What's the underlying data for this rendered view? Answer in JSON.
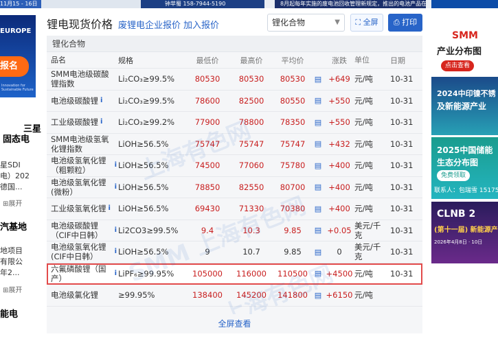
{
  "top_strip": {
    "left_text": "11月15 - 16日",
    "mid_text": "钟苹蜀 158-7944-5190",
    "right_text": "8月起每年实施的废电池回收管理新规定，推出的电池产品在新能源车..."
  },
  "left_sidebar": {
    "ad_line1": "EUROPE",
    "ad_line2": "报名",
    "ad_caption": "Innovation for Sustainable Future",
    "item1_title_a": "三星",
    "item1_title_b": "固态电",
    "item1_text_a": "星SDI",
    "item1_text_b": "电）202",
    "item1_text_c": "德国...",
    "expand_label": "展开",
    "item2_title": "汽基地",
    "item2_text_a": "地项目",
    "item2_text_b": "有限公",
    "item2_text_c": "年2...",
    "item3_title": "能电"
  },
  "header": {
    "title": "锂电现货价格",
    "link1": "废锂电企业报价",
    "link2": "加入报价",
    "select_value": "锂化合物",
    "fullscreen_label": "全屏",
    "print_label": "打印"
  },
  "table": {
    "section_title": "锂化合物",
    "columns": [
      "品名",
      "规格",
      "最低价",
      "最高价",
      "平均价",
      "涨跌",
      "单位",
      "日期"
    ],
    "rows": [
      {
        "name": "SMM电池级碳酸锂指数",
        "spec": "Li₂CO₃≥99.5%",
        "min": "80530",
        "max": "80530",
        "avg": "80530",
        "change": "+649",
        "unit": "元/吨",
        "date": "10-31",
        "info": false
      },
      {
        "name": "电池级碳酸锂",
        "spec": "Li₂CO₃≥99.5%",
        "min": "78600",
        "max": "82500",
        "avg": "80550",
        "change": "+550",
        "unit": "元/吨",
        "date": "10-31",
        "info": true
      },
      {
        "name": "工业级碳酸锂",
        "spec": "Li₂CO₃≥99.2%",
        "min": "77900",
        "max": "78800",
        "avg": "78350",
        "change": "+550",
        "unit": "元/吨",
        "date": "10-31",
        "info": true
      },
      {
        "name": "SMM电池级氢氧化锂指数",
        "spec": "LiOH≥56.5%",
        "min": "75747",
        "max": "75747",
        "avg": "75747",
        "change": "+432",
        "unit": "元/吨",
        "date": "10-31",
        "info": false
      },
      {
        "name": "电池级氢氧化锂（粗颗粒）",
        "spec": "LiOH≥56.5%",
        "min": "74500",
        "max": "77060",
        "avg": "75780",
        "change": "+400",
        "unit": "元/吨",
        "date": "10-31",
        "info": true
      },
      {
        "name": "电池级氢氧化锂(微粉）",
        "spec": "LiOH≥56.5%",
        "min": "78850",
        "max": "82550",
        "avg": "80700",
        "change": "+400",
        "unit": "元/吨",
        "date": "10-31",
        "info": true
      },
      {
        "name": "工业级氢氧化锂",
        "spec": "LiOH≥56.5%",
        "min": "69430",
        "max": "71330",
        "avg": "70380",
        "change": "+400",
        "unit": "元/吨",
        "date": "10-31",
        "info": true
      },
      {
        "name": "电池级碳酸锂（CIF中日韩）",
        "spec": "Li2CO3≥99.5%",
        "min": "9.4",
        "max": "10.3",
        "avg": "9.85",
        "change": "+0.05",
        "unit": "美元/千克",
        "date": "10-31",
        "info": true
      },
      {
        "name": "电池级氢氧化锂(CIF中日韩）",
        "spec": "LiOH≥56.5%",
        "min": "9",
        "max": "10.7",
        "avg": "9.85",
        "change": "0",
        "unit": "美元/千克",
        "date": "10-31",
        "info": true
      },
      {
        "name": "六氟磷酸锂（国产）",
        "spec": "LiPF₆≥99.95%",
        "min": "105000",
        "max": "116000",
        "avg": "110500",
        "change": "+4500",
        "unit": "元/吨",
        "date": "10-31",
        "info": true,
        "highlight": true
      },
      {
        "name": "电池级氯化锂",
        "spec": "≥99.95%",
        "min": "138400",
        "max": "145200",
        "avg": "141800",
        "change": "+6150",
        "unit": "元/吨",
        "date": "",
        "info": false
      }
    ],
    "view_all": "全屏查看"
  },
  "watermarks": [
    "上海有色网",
    "SMM 上海有色网",
    "上海有色网"
  ],
  "right_ads": {
    "ad1_brand": "SMM",
    "ad1_title": "产业分布图",
    "ad1_button": "点击查看",
    "ad2_title_a": "2024中印镍不锈",
    "ad2_title_b": "及新能源产业",
    "ad3_title_a": "2025中国储能",
    "ad3_title_b": "生态分布图",
    "ad3_button": "免费领取",
    "ad3_contact": "联系人：包瑞雪 15175",
    "ad4_title_a": "CLNB 2",
    "ad4_title_b": "(第十一届) 新能源产",
    "ad4_date": "2026年4月8日 · 10日"
  },
  "colors": {
    "accent": "#2864c8",
    "price_red": "#c81e1e",
    "highlight_border": "#e24a4a"
  }
}
